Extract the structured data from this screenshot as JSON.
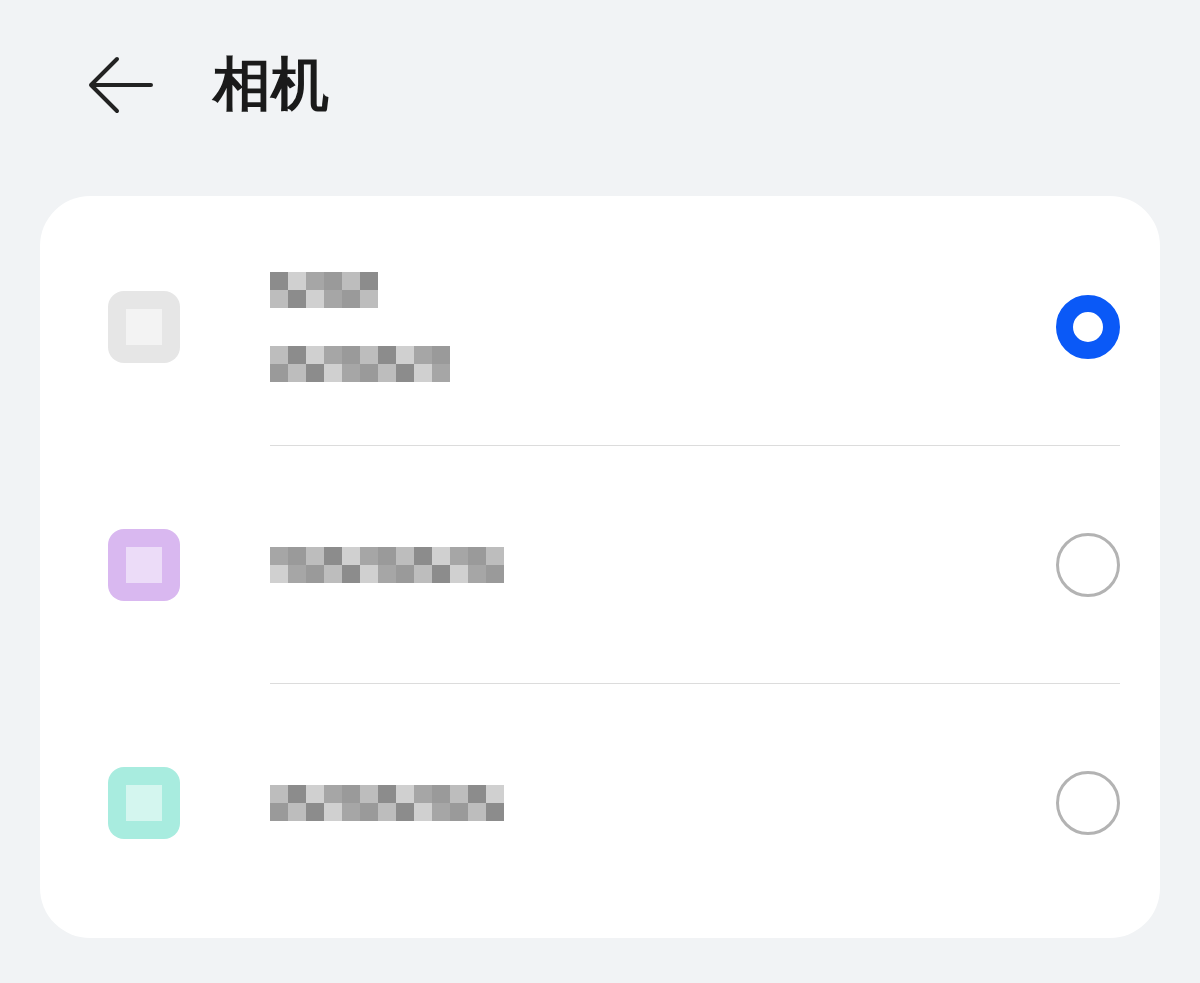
{
  "header": {
    "title": "相机"
  },
  "options": [
    {
      "kind": "two_line",
      "color": "#e6e6e6",
      "selected": true
    },
    {
      "kind": "one_line",
      "color": "#d9b8f0",
      "selected": false
    },
    {
      "kind": "one_line",
      "color": "#a8ecdf",
      "selected": false
    }
  ]
}
